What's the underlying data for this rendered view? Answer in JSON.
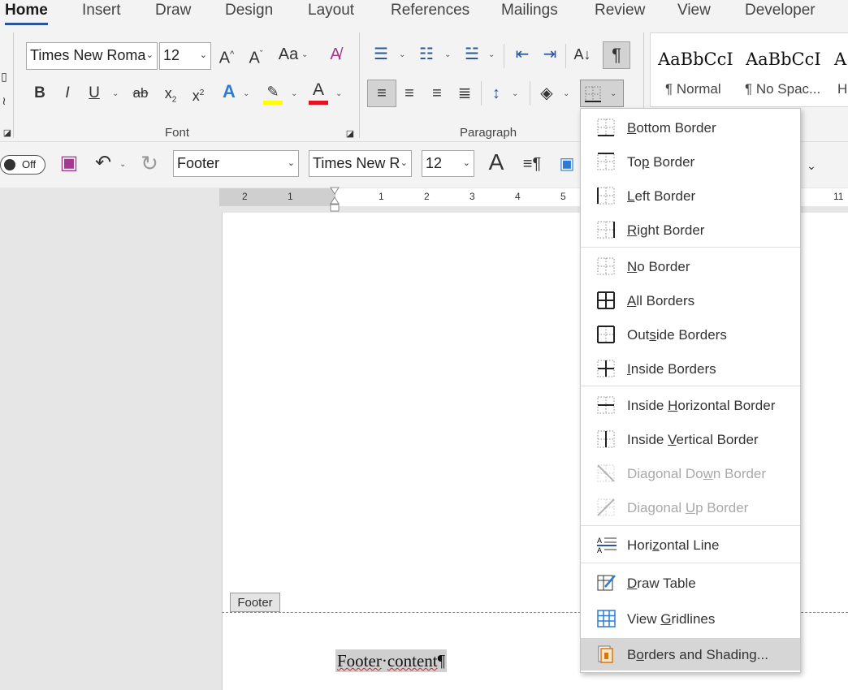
{
  "tabs": [
    "Home",
    "Insert",
    "Draw",
    "Design",
    "Layout",
    "References",
    "Mailings",
    "Review",
    "View",
    "Developer"
  ],
  "active_tab": "Home",
  "font": {
    "name": "Times New Roma",
    "size": "12",
    "group_label": "Font",
    "change_case_label": "Aa"
  },
  "paragraph": {
    "group_label": "Paragraph"
  },
  "styles": [
    {
      "sample": "AaBbCcI",
      "name": "¶ Normal"
    },
    {
      "sample": "AaBbCcI",
      "name": "¶ No Spac..."
    },
    {
      "sample": "A",
      "name": "H"
    }
  ],
  "qat": {
    "toggle_label": "Off",
    "style": "Footer",
    "font": "Times New R",
    "size": "12"
  },
  "ruler": {
    "left_marks": [
      "2",
      "1"
    ],
    "right_marks": [
      "1",
      "2",
      "3",
      "4",
      "5"
    ],
    "far_right_mark": "11"
  },
  "document": {
    "footer_tag": "Footer",
    "footer_word1": "Footer",
    "footer_dot": "·",
    "footer_word2": "content",
    "pilcrow": "¶"
  },
  "menu": {
    "items": [
      {
        "pre": "",
        "u": "B",
        "post": "ottom Border",
        "icon": "bottom-border-icon"
      },
      {
        "pre": "To",
        "u": "p",
        "post": " Border",
        "icon": "top-border-icon"
      },
      {
        "pre": "",
        "u": "L",
        "post": "eft Border",
        "icon": "left-border-icon"
      },
      {
        "pre": "",
        "u": "R",
        "post": "ight Border",
        "icon": "right-border-icon"
      },
      {
        "pre": "",
        "u": "N",
        "post": "o Border",
        "icon": "no-border-icon"
      },
      {
        "pre": "",
        "u": "A",
        "post": "ll Borders",
        "icon": "all-borders-icon"
      },
      {
        "pre": "Out",
        "u": "s",
        "post": "ide Borders",
        "icon": "outside-borders-icon"
      },
      {
        "pre": "",
        "u": "I",
        "post": "nside Borders",
        "icon": "inside-borders-icon"
      },
      {
        "pre": "Inside ",
        "u": "H",
        "post": "orizontal Border",
        "icon": "inside-horizontal-border-icon"
      },
      {
        "pre": "Inside ",
        "u": "V",
        "post": "ertical Border",
        "icon": "inside-vertical-border-icon"
      },
      {
        "pre": "Diagonal Do",
        "u": "w",
        "post": "n Border",
        "icon": "diagonal-down-border-icon",
        "disabled": true
      },
      {
        "pre": "Diagonal ",
        "u": "U",
        "post": "p Border",
        "icon": "diagonal-up-border-icon",
        "disabled": true
      },
      {
        "pre": "Hori",
        "u": "z",
        "post": "ontal Line",
        "icon": "horizontal-line-icon"
      },
      {
        "pre": "",
        "u": "D",
        "post": "raw Table",
        "icon": "draw-table-icon"
      },
      {
        "pre": "View ",
        "u": "G",
        "post": "ridlines",
        "icon": "view-gridlines-icon"
      },
      {
        "pre": "B",
        "u": "o",
        "post": "rders and Shading...",
        "icon": "borders-shading-icon"
      }
    ]
  },
  "colors": {
    "accent": "#2b579a",
    "highlight": "#ffff00",
    "font_color": "#e81123",
    "save": "#a4378f"
  }
}
